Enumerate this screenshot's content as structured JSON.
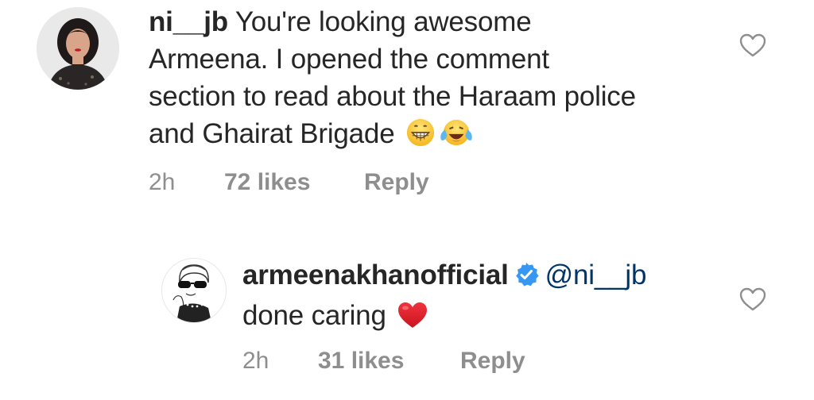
{
  "comments": [
    {
      "username": "ni__jb",
      "text_line1": " You're looking awesome",
      "text_rest": "Armeena. I opened the comment section to read about the Haraam police and Ghairat Brigade",
      "emojis": [
        "grinning-face-icon",
        "tears-of-joy-icon"
      ],
      "time": "2h",
      "likes": "72 likes",
      "reply": "Reply"
    },
    {
      "username": "armeenakhanofficial",
      "verified": true,
      "mention": "@ni__jb",
      "text": "done caring",
      "emojis": [
        "red-heart-icon"
      ],
      "time": "2h",
      "likes": "31 likes",
      "reply": "Reply"
    }
  ],
  "colors": {
    "text": "#262626",
    "meta": "#8e8e8e",
    "mention": "#003569",
    "verified": "#3897f0",
    "heart_outline": "#8e8e8e",
    "red_heart": "#e0262f"
  }
}
